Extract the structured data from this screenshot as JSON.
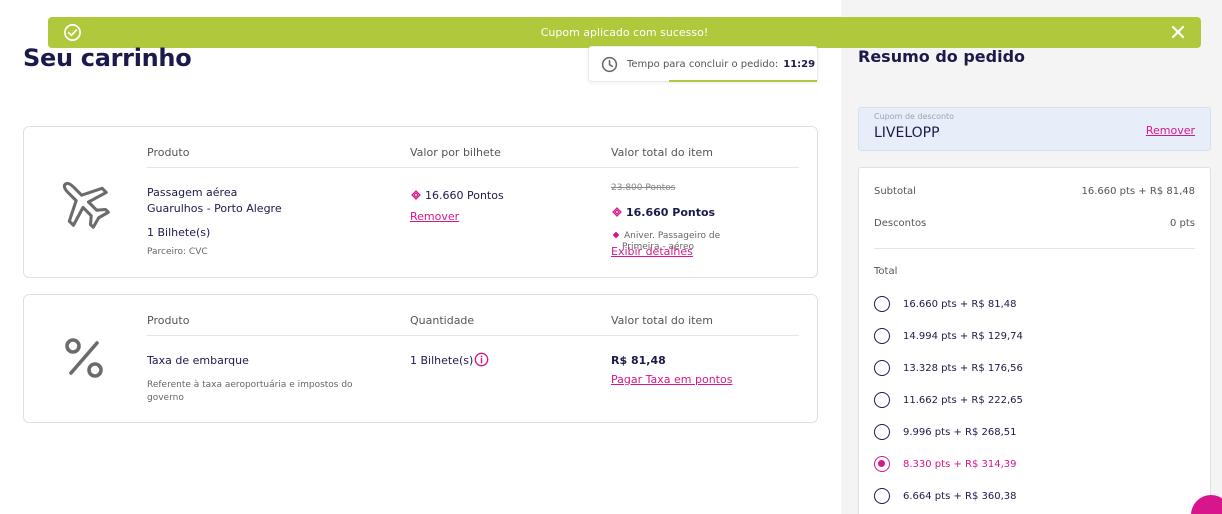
{
  "toast": {
    "message": "Cupom aplicado com sucesso!"
  },
  "page": {
    "title": "Seu carrinho"
  },
  "timer": {
    "label": "Tempo para concluir o pedido:",
    "value": "11:29"
  },
  "flight_item": {
    "headers": {
      "product": "Produto",
      "unit_price": "Valor por bilhete",
      "total": "Valor total do item"
    },
    "name": "Passagem aérea",
    "route": "Guarulhos - Porto Alegre",
    "tickets": "1 Bilhete(s)",
    "partner": "Parceiro: CVC",
    "unit_price": "16.660 Pontos",
    "remove_label": "Remover",
    "old_total": "23.800 Pontos",
    "total": "16.660 Pontos",
    "promo_line1": "Aniver. Passageiro de",
    "promo_line2": "Primeira - aéreo",
    "details_label": "Exibir detalhes"
  },
  "fee_item": {
    "headers": {
      "product": "Produto",
      "quantity": "Quantidade",
      "total": "Valor total do item"
    },
    "name": "Taxa de embarque",
    "desc_line1": "Referente à taxa aeroportuária e impostos do",
    "desc_line2": "governo",
    "quantity": "1 Bilhete(s)",
    "total": "R$ 81,48",
    "pay_points_label": "Pagar Taxa em pontos"
  },
  "summary": {
    "title": "Resumo do pedido",
    "coupon": {
      "label": "Cupom de desconto",
      "code": "LIVELOPP",
      "remove_label": "Remover"
    },
    "subtotal_label": "Subtotal",
    "subtotal_value": "16.660 pts + R$ 81,48",
    "discounts_label": "Descontos",
    "discounts_value": "0 pts",
    "total_label": "Total",
    "options": [
      {
        "label": "16.660 pts + R$ 81,48"
      },
      {
        "label": "14.994 pts + R$ 129,74"
      },
      {
        "label": "13.328 pts + R$ 176,56"
      },
      {
        "label": "11.662 pts + R$ 222,65"
      },
      {
        "label": "9.996 pts + R$ 268,51"
      },
      {
        "label": "8.330 pts + R$ 314,39"
      },
      {
        "label": "6.664 pts + R$ 360,38"
      }
    ],
    "selected_option": 5
  },
  "colors": {
    "brand_pink": "#d6168a",
    "success_green": "#b0c83b",
    "navy": "#1b1a4b"
  }
}
